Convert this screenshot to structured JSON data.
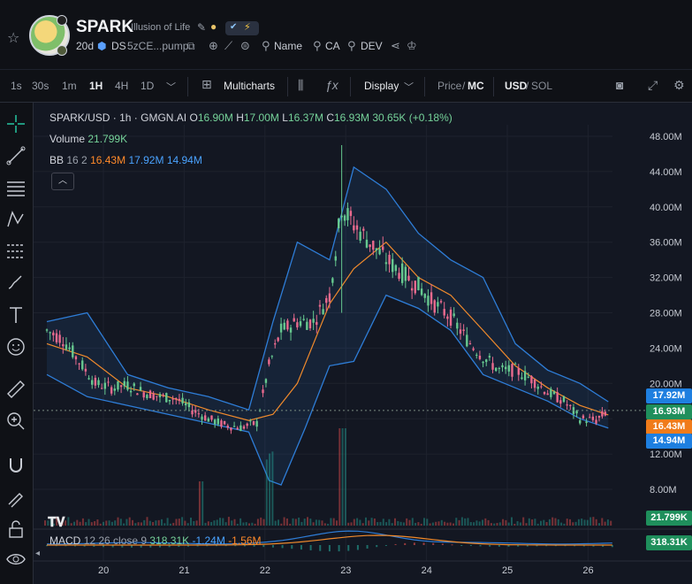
{
  "header": {
    "symbol": "SPARK",
    "name": "Illusion of Life",
    "age": "20d",
    "dex": "DS",
    "contract_short": "5zCE...pump",
    "links": [
      "Name",
      "CA",
      "DEV"
    ]
  },
  "toolbar": {
    "timeframes": [
      "1s",
      "30s",
      "1m",
      "1H",
      "4H",
      "1D"
    ],
    "active_timeframe": "1H",
    "multicharts_label": "Multicharts",
    "display_label": "Display",
    "price_label": "Price",
    "mc_label": "MC",
    "usd_label": "USD",
    "sol_label": "SOL"
  },
  "legend": {
    "pair": "SPARK/USD · 1h · GMGN.AI",
    "o_label": "O",
    "o_value": "16.90M",
    "h_label": "H",
    "h_value": "17.00M",
    "l_label": "L",
    "l_value": "16.37M",
    "c_label": "C",
    "c_value": "16.93M",
    "change": "30.65K (+0.18%)",
    "volume_label": "Volume",
    "volume_value": "21.799K",
    "bb_label": "BB",
    "bb_params": "16 2",
    "bb_mid": "16.43M",
    "bb_upper": "17.92M",
    "bb_lower": "14.94M",
    "macd_label": "MACD",
    "macd_params": "12 26 close 9",
    "macd_value": "318.31K",
    "macd_signal": "-1.24M",
    "macd_hist": "-1.56M"
  },
  "price_tags": {
    "upper": "17.92M",
    "last": "16.93M",
    "mid": "16.43M",
    "lower": "14.94M",
    "volume": "21.799K",
    "macd": "318.31K"
  },
  "colors": {
    "up": "#26a69a",
    "down": "#ef5350",
    "up_candle": "#66c88f",
    "down_candle": "#ea6a8e",
    "bb_band": "#2e7dd7",
    "bb_mid": "#f08a2c",
    "bg": "#131722"
  },
  "chart_data": {
    "type": "candlestick",
    "title": "SPARK/USD · 1h · GMGN.AI",
    "x_ticks": [
      "20",
      "21",
      "22",
      "23",
      "24",
      "25",
      "26"
    ],
    "y_ticks": [
      "48.00M",
      "44.00M",
      "40.00M",
      "36.00M",
      "32.00M",
      "28.00M",
      "24.00M",
      "20.00M",
      "16.00M",
      "12.00M",
      "8.00M"
    ],
    "ylim": [
      4.8,
      49.5
    ],
    "y_unit": "M USD",
    "close_series_approx": [
      {
        "t": 19.3,
        "close": 26.0
      },
      {
        "t": 19.5,
        "close": 25.0
      },
      {
        "t": 19.7,
        "close": 22.5
      },
      {
        "t": 19.9,
        "close": 20.0
      },
      {
        "t": 20.1,
        "close": 19.5
      },
      {
        "t": 20.3,
        "close": 19.8
      },
      {
        "t": 20.5,
        "close": 19.0
      },
      {
        "t": 20.7,
        "close": 18.5
      },
      {
        "t": 20.9,
        "close": 18.3
      },
      {
        "t": 21.1,
        "close": 17.0
      },
      {
        "t": 21.3,
        "close": 16.0
      },
      {
        "t": 21.5,
        "close": 15.3
      },
      {
        "t": 21.7,
        "close": 15.0
      },
      {
        "t": 21.9,
        "close": 15.5
      },
      {
        "t": 22.05,
        "close": 22.0
      },
      {
        "t": 22.2,
        "close": 26.0
      },
      {
        "t": 22.4,
        "close": 27.0
      },
      {
        "t": 22.6,
        "close": 27.0
      },
      {
        "t": 22.8,
        "close": 30.0
      },
      {
        "t": 22.95,
        "close": 40.0
      },
      {
        "t": 23.1,
        "close": 38.0
      },
      {
        "t": 23.3,
        "close": 36.0
      },
      {
        "t": 23.5,
        "close": 34.0
      },
      {
        "t": 23.7,
        "close": 32.5
      },
      {
        "t": 23.9,
        "close": 31.0
      },
      {
        "t": 24.1,
        "close": 29.0
      },
      {
        "t": 24.3,
        "close": 27.5
      },
      {
        "t": 24.5,
        "close": 25.0
      },
      {
        "t": 24.7,
        "close": 23.0
      },
      {
        "t": 24.9,
        "close": 21.5
      },
      {
        "t": 25.1,
        "close": 21.5
      },
      {
        "t": 25.3,
        "close": 20.5
      },
      {
        "t": 25.5,
        "close": 19.0
      },
      {
        "t": 25.7,
        "close": 18.0
      },
      {
        "t": 25.9,
        "close": 16.0
      },
      {
        "t": 26.1,
        "close": 15.8
      },
      {
        "t": 26.25,
        "close": 16.93
      }
    ],
    "bb_upper_approx": [
      {
        "t": 19.3,
        "v": 27.0
      },
      {
        "t": 19.8,
        "v": 28.0
      },
      {
        "t": 20.3,
        "v": 21.0
      },
      {
        "t": 20.8,
        "v": 19.5
      },
      {
        "t": 21.3,
        "v": 18.5
      },
      {
        "t": 21.8,
        "v": 17.0
      },
      {
        "t": 22.1,
        "v": 27.0
      },
      {
        "t": 22.4,
        "v": 36.0
      },
      {
        "t": 22.8,
        "v": 34.0
      },
      {
        "t": 23.1,
        "v": 44.5
      },
      {
        "t": 23.5,
        "v": 42.0
      },
      {
        "t": 23.9,
        "v": 37.0
      },
      {
        "t": 24.3,
        "v": 34.0
      },
      {
        "t": 24.7,
        "v": 32.0
      },
      {
        "t": 25.1,
        "v": 24.5
      },
      {
        "t": 25.5,
        "v": 21.5
      },
      {
        "t": 25.9,
        "v": 20.0
      },
      {
        "t": 26.25,
        "v": 17.92
      }
    ],
    "bb_mid_approx": [
      {
        "t": 19.3,
        "v": 24.5
      },
      {
        "t": 19.8,
        "v": 23.0
      },
      {
        "t": 20.3,
        "v": 19.5
      },
      {
        "t": 20.8,
        "v": 18.5
      },
      {
        "t": 21.3,
        "v": 17.0
      },
      {
        "t": 21.8,
        "v": 15.8
      },
      {
        "t": 22.1,
        "v": 16.5
      },
      {
        "t": 22.4,
        "v": 20.0
      },
      {
        "t": 22.8,
        "v": 29.0
      },
      {
        "t": 23.1,
        "v": 33.0
      },
      {
        "t": 23.5,
        "v": 36.0
      },
      {
        "t": 23.9,
        "v": 32.0
      },
      {
        "t": 24.3,
        "v": 30.0
      },
      {
        "t": 24.7,
        "v": 26.0
      },
      {
        "t": 25.1,
        "v": 22.0
      },
      {
        "t": 25.5,
        "v": 19.5
      },
      {
        "t": 25.9,
        "v": 17.5
      },
      {
        "t": 26.25,
        "v": 16.43
      }
    ],
    "bb_lower_approx": [
      {
        "t": 19.3,
        "v": 21.0
      },
      {
        "t": 19.8,
        "v": 18.5
      },
      {
        "t": 20.3,
        "v": 17.5
      },
      {
        "t": 20.8,
        "v": 16.5
      },
      {
        "t": 21.3,
        "v": 15.5
      },
      {
        "t": 21.8,
        "v": 14.5
      },
      {
        "t": 22.05,
        "v": 9.0
      },
      {
        "t": 22.2,
        "v": 8.5
      },
      {
        "t": 22.5,
        "v": 15.0
      },
      {
        "t": 22.8,
        "v": 22.0
      },
      {
        "t": 23.1,
        "v": 22.5
      },
      {
        "t": 23.5,
        "v": 30.0
      },
      {
        "t": 23.9,
        "v": 28.5
      },
      {
        "t": 24.3,
        "v": 26.0
      },
      {
        "t": 24.7,
        "v": 21.0
      },
      {
        "t": 25.1,
        "v": 19.5
      },
      {
        "t": 25.5,
        "v": 18.0
      },
      {
        "t": 25.9,
        "v": 16.0
      },
      {
        "t": 26.25,
        "v": 14.94
      }
    ]
  }
}
